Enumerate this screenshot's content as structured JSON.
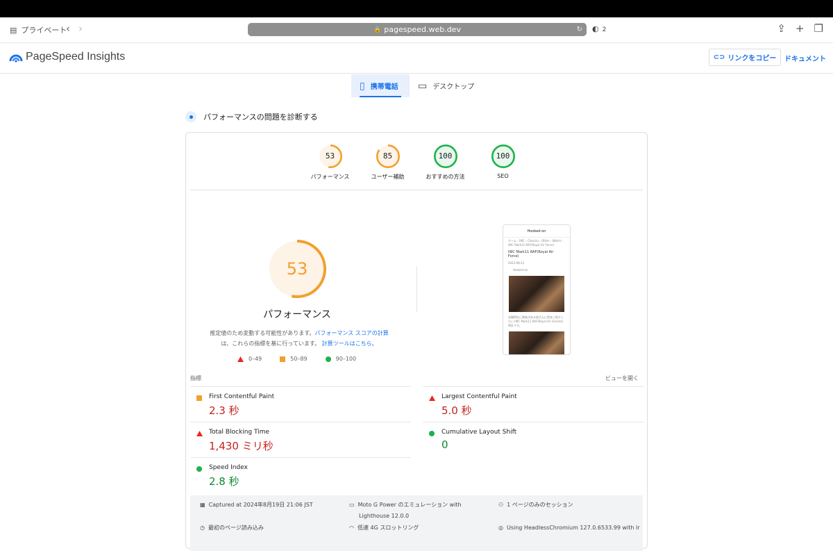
{
  "browser": {
    "private_label": "プライベート",
    "url": "pagespeed.web.dev",
    "shield_count": "2"
  },
  "header": {
    "brand": "PageSpeed Insights",
    "copy_link": "リンクをコピー",
    "docs": "ドキュメント"
  },
  "tabs": [
    {
      "label": "携帯電話",
      "icon": "phone-icon"
    },
    {
      "label": "デスクトップ",
      "icon": "laptop-icon"
    }
  ],
  "section_title": "パフォーマンスの問題を診断する",
  "scores": [
    {
      "label": "パフォーマンス",
      "value": "53",
      "color": "#f29f2f"
    },
    {
      "label": "ユーザー補助",
      "value": "85",
      "color": "#f29f2f"
    },
    {
      "label": "おすすめの方法",
      "value": "100",
      "color": "#1bb34b"
    },
    {
      "label": "SEO",
      "value": "100",
      "color": "#1bb34b"
    }
  ],
  "performance": {
    "score": "53",
    "title": "パフォーマンス",
    "note_prefix": "推定値のため変動する可能性があります。",
    "note_link1": "パフォーマンス スコアの計算",
    "note_mid": "は、これらの指標を基に行っています。",
    "note_link2": "計算ツールはこちら。",
    "legend": [
      "0–49",
      "50–89",
      "90–100"
    ]
  },
  "screenshot": {
    "site": "Hooked-on",
    "breadcrumb": "ホーム › IWC › Classics › Other › Watch › IWC Mark11 RAF(Royal Air Force)",
    "post_title": "IWC Mark11 RAF(Royal Air Force)",
    "date": "2023-08-21",
    "caption": "Hooked-on",
    "body": "あ腕時計に興味がある皆さんに是非ご紹介したい IWC Mark11 RAF(Royal Air Force)の時計です。"
  },
  "metrics": {
    "heading": "指標",
    "expand": "ビューを開く",
    "left": [
      {
        "name": "First Contentful Paint",
        "value": "2.3 秒",
        "status": "orange"
      },
      {
        "name": "Total Blocking Time",
        "value": "1,430 ミリ秒",
        "status": "red"
      },
      {
        "name": "Speed Index",
        "value": "2.8 秒",
        "status": "green"
      }
    ],
    "right": [
      {
        "name": "Largest Contentful Paint",
        "value": "5.0 秒",
        "status": "red"
      },
      {
        "name": "Cumulative Layout Shift",
        "value": "0",
        "status": "green"
      }
    ]
  },
  "footer": {
    "captured": "Captured at 2024年8月19日 21:06 JST",
    "emulation": "Moto G Power のエミュレーション with",
    "lighthouse": "Lighthouse 12.0.0",
    "session": "1 ページのみのセッション",
    "first_load": "最初のページ読み込み",
    "throttle": "低速 4G スロットリング",
    "browser": "Using HeadlessChromium 127.0.6533.99 with lr"
  }
}
